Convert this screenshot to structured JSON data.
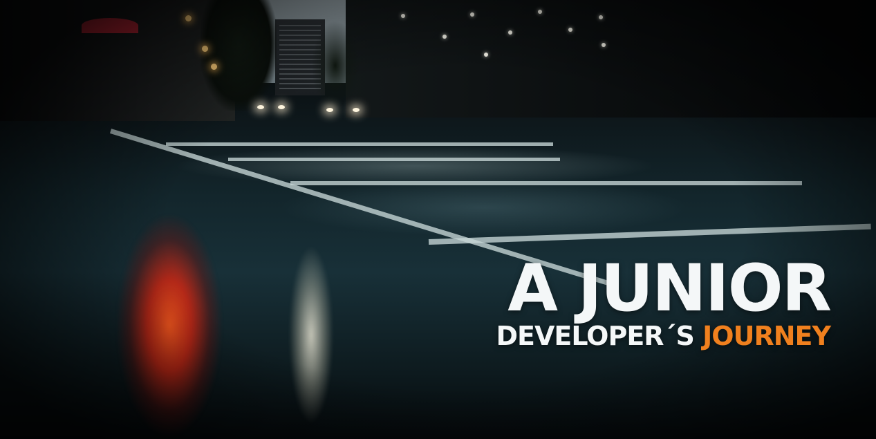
{
  "headline": {
    "line1": "A JUNIOR",
    "line2_main": "DEVELOPER´S",
    "line2_accent": "JOURNEY"
  },
  "colors": {
    "text": "#f4f7f8",
    "accent": "#f0801e"
  }
}
